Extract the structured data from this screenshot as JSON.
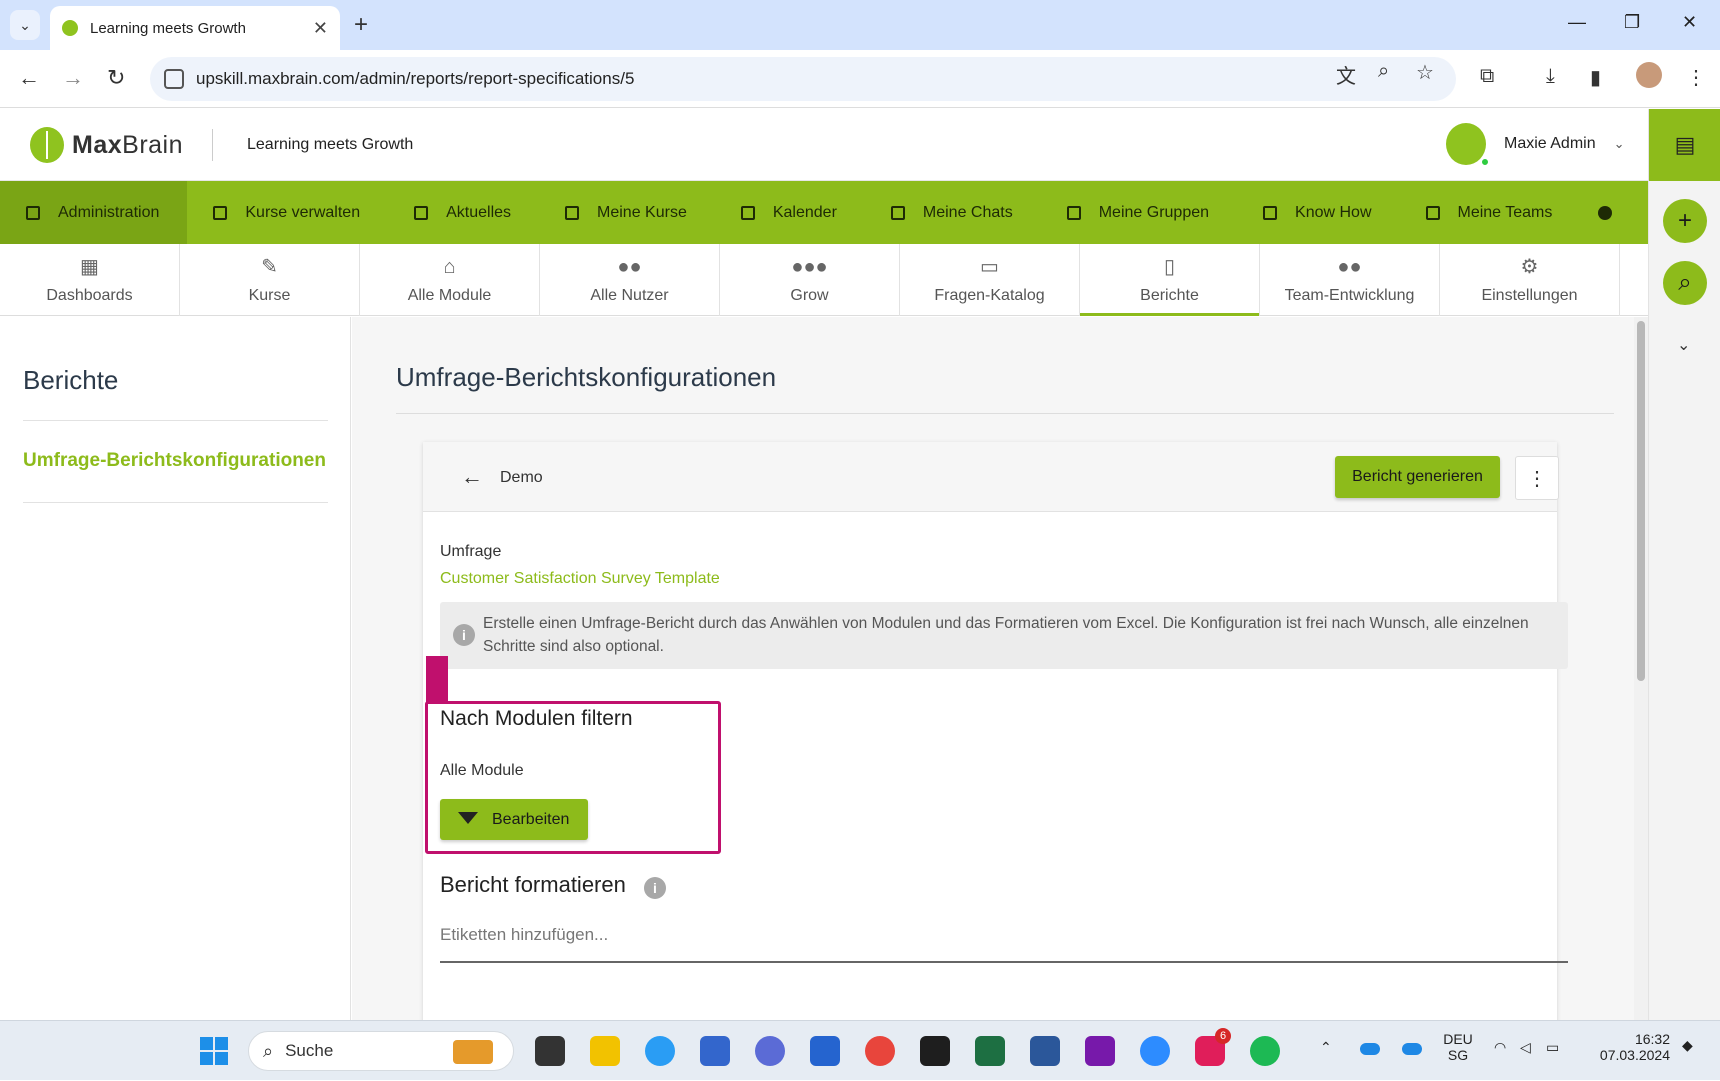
{
  "browser": {
    "tab_title": "Learning meets Growth",
    "url": "upskill.maxbrain.com/admin/reports/report-specifications/5",
    "new_tab_symbol": "+",
    "close_tab_symbol": "✕",
    "window_controls": [
      "—",
      "❐",
      "✕"
    ]
  },
  "app": {
    "logo_text_bold": "Max",
    "logo_text_light": "Brain",
    "slogan": "Learning meets Growth",
    "user_name": "Maxie Admin",
    "accent_color": "#8dbb1b",
    "highlight_color": "#c0106d"
  },
  "main_nav": [
    {
      "label": "Administration",
      "icon": "dashboard-icon",
      "active": true
    },
    {
      "label": "Kurse verwalten",
      "icon": "folder-icon"
    },
    {
      "label": "Aktuelles",
      "icon": "grid-icon"
    },
    {
      "label": "Meine Kurse",
      "icon": "graduation-cap-icon"
    },
    {
      "label": "Kalender",
      "icon": "calendar-icon"
    },
    {
      "label": "Meine Chats",
      "icon": "chat-icon"
    },
    {
      "label": "Meine Gruppen",
      "icon": "group-folder-icon"
    },
    {
      "label": "Know How",
      "icon": "book-icon"
    },
    {
      "label": "Meine Teams",
      "icon": "team-icon"
    }
  ],
  "module_nav": [
    {
      "label": "Dashboards",
      "icon": "dashboard-icon"
    },
    {
      "label": "Kurse",
      "icon": "course-icon"
    },
    {
      "label": "Alle Module",
      "icon": "institution-icon"
    },
    {
      "label": "Alle Nutzer",
      "icon": "users-icon"
    },
    {
      "label": "Grow",
      "icon": "people-group-icon"
    },
    {
      "label": "Fragen-Katalog",
      "icon": "question-chat-icon"
    },
    {
      "label": "Berichte",
      "icon": "report-icon",
      "active": true
    },
    {
      "label": "Team-Entwicklung",
      "icon": "team-development-icon"
    },
    {
      "label": "Einstellungen",
      "icon": "settings-icon"
    }
  ],
  "sidebar": {
    "title": "Berichte",
    "item": "Umfrage-Berichtskonfigurationen"
  },
  "page": {
    "title": "Umfrage-Berichtskonfigurationen",
    "card": {
      "name": "Demo",
      "generate_button": "Bericht generieren",
      "survey_label": "Umfrage",
      "survey_value": "Customer Satisfaction Survey Template",
      "info_text": "Erstelle einen Umfrage-Bericht durch das Anwählen von Modulen und das Formatieren vom Excel. Die Konfiguration ist frei nach Wunsch, alle einzelnen Schritte sind also optional.",
      "filter_title": "Nach Modulen filtern",
      "filter_value": "Alle Module",
      "edit_button": "Bearbeiten",
      "format_title": "Bericht formatieren",
      "tags_placeholder": "Etiketten hinzufügen..."
    }
  },
  "taskbar": {
    "search_placeholder": "Suche",
    "lang_line1": "DEU",
    "lang_line2": "SG",
    "time": "16:32",
    "date": "07.03.2024",
    "badge": "6"
  }
}
